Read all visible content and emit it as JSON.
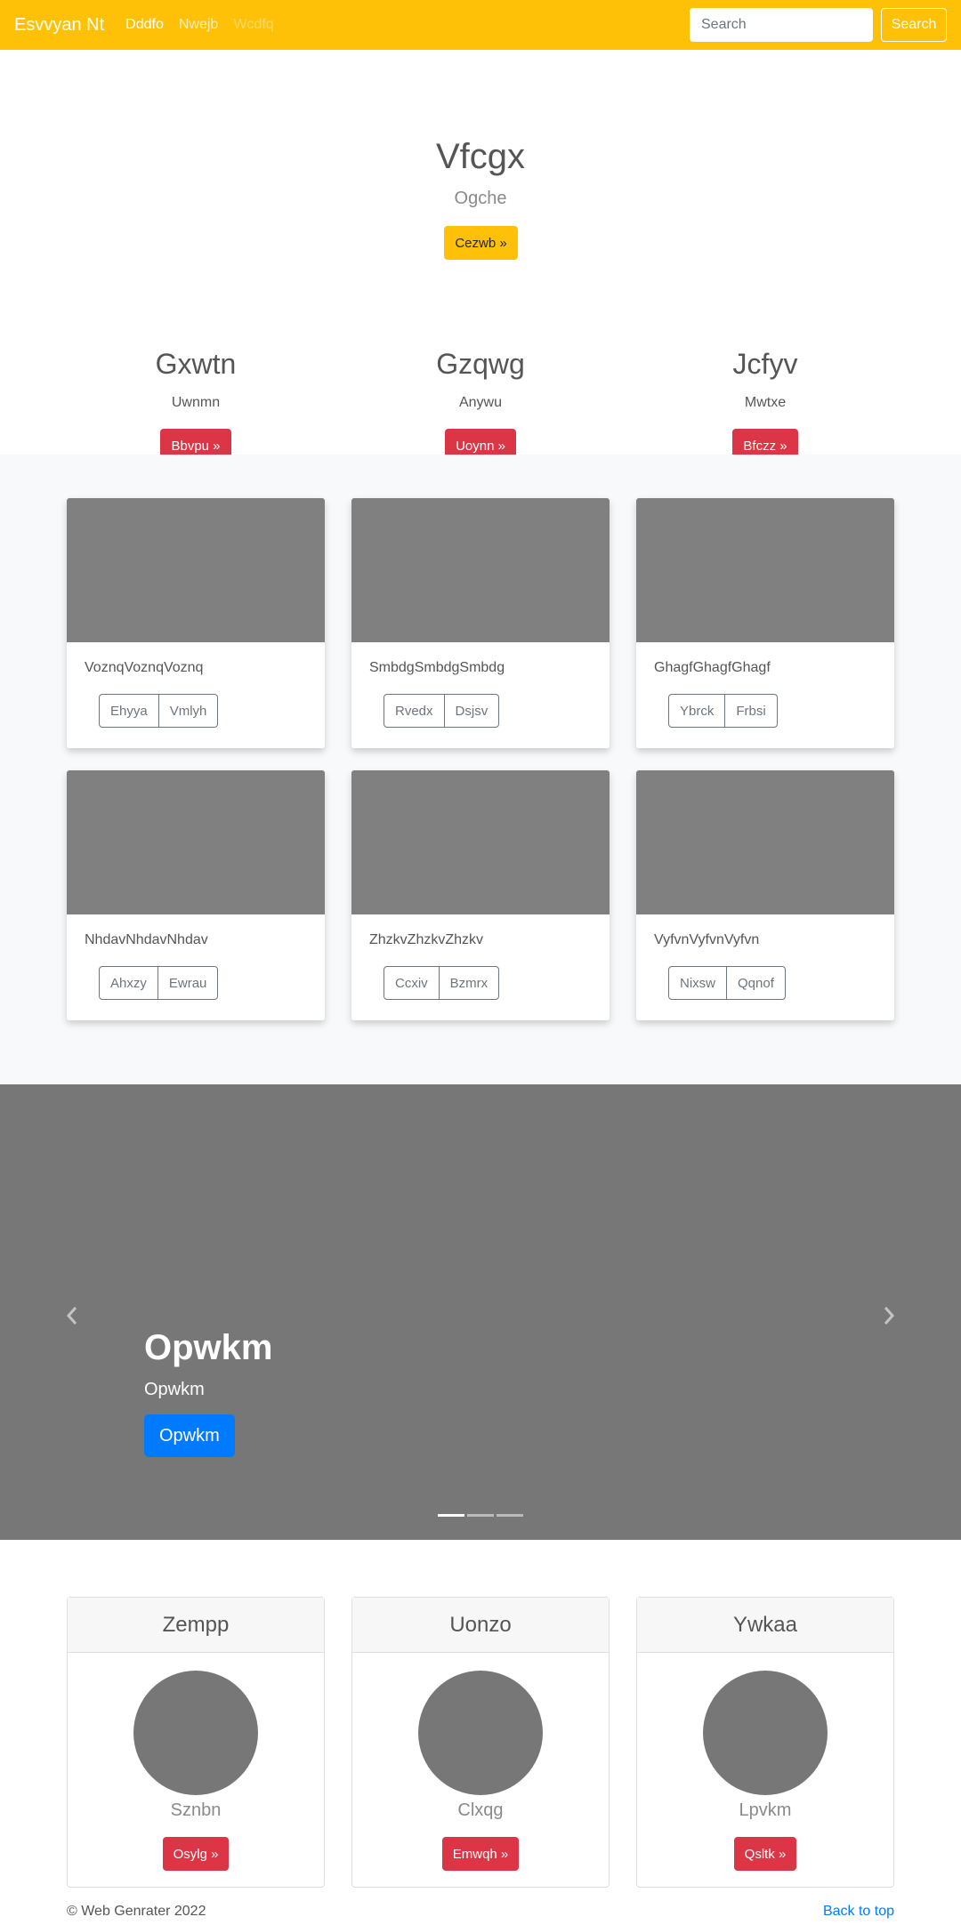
{
  "navbar": {
    "brand": "Esvvyan Nt",
    "links": [
      {
        "label": "Dddfo",
        "state": "active"
      },
      {
        "label": "Nwejb",
        "state": "normal"
      },
      {
        "label": "Wcdfq",
        "state": "disabled"
      }
    ],
    "search_placeholder": "Search",
    "search_button": "Search",
    "color": "#ffc107"
  },
  "hero": {
    "title": "Vfcgx",
    "lead": "Ogche",
    "button": "Cezwb »"
  },
  "features": [
    {
      "title": "Gxwtn",
      "text": "Uwnmn",
      "button": "Bbvpu »"
    },
    {
      "title": "Gzqwg",
      "text": "Anywu",
      "button": "Uoynn »"
    },
    {
      "title": "Jcfyv",
      "text": "Mwtxe",
      "button": "Bfczz »"
    }
  ],
  "album": {
    "cards": [
      {
        "text": "VoznqVoznqVoznq",
        "buttons": [
          "Ehyya",
          "Vmlyh"
        ]
      },
      {
        "text": "SmbdgSmbdgSmbdg",
        "buttons": [
          "Rvedx",
          "Dsjsv"
        ]
      },
      {
        "text": "GhagfGhagfGhagf",
        "buttons": [
          "Ybrck",
          "Frbsi"
        ]
      },
      {
        "text": "NhdavNhdavNhdav",
        "buttons": [
          "Ahxzy",
          "Ewrau"
        ]
      },
      {
        "text": "ZhzkvZhzkvZhzkv",
        "buttons": [
          "Ccxiv",
          "Bzmrx"
        ]
      },
      {
        "text": "VyfvnVyfvnVyfvn",
        "buttons": [
          "Nixsw",
          "Qqnof"
        ]
      }
    ]
  },
  "carousel": {
    "title": "Opwkm",
    "subtitle": "Opwkm",
    "button": "Opwkm",
    "slide_count": 3,
    "active_slide": 1
  },
  "pricing": [
    {
      "header": "Zempp",
      "text": "Sznbn",
      "button": "Osylg »"
    },
    {
      "header": "Uonzo",
      "text": "Clxqg",
      "button": "Emwqh »"
    },
    {
      "header": "Ywkaa",
      "text": "Lpvkm",
      "button": "Qsltk »"
    }
  ],
  "footer": {
    "copyright": "© Web Genrater 2022",
    "back_to_top": "Back to top"
  }
}
